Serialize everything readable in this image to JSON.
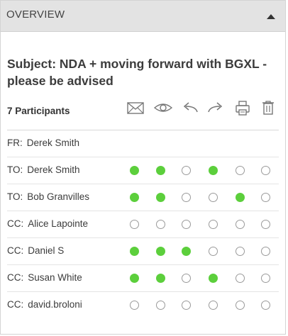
{
  "header": {
    "title": "OVERVIEW",
    "collapse_icon": "caret-up-icon"
  },
  "subject": "Subject: NDA + moving forward with BGXL - please be advised",
  "participants": {
    "count_label": "7 Participants"
  },
  "toolbar": {
    "icons": [
      "envelope-icon",
      "eye-icon",
      "reply-icon",
      "forward-icon",
      "print-icon",
      "trash-icon"
    ]
  },
  "colors": {
    "active_dot": "#5ccf3c",
    "header_bg": "#e3e3e3"
  },
  "rows": [
    {
      "role": "FR:",
      "name": "Derek Smith",
      "status": null
    },
    {
      "role": "TO:",
      "name": "Derek Smith",
      "status": [
        1,
        1,
        0,
        1,
        0,
        0
      ]
    },
    {
      "role": "TO:",
      "name": "Bob Granvilles",
      "status": [
        1,
        1,
        0,
        0,
        1,
        0
      ]
    },
    {
      "role": "CC:",
      "name": "Alice Lapointe",
      "status": [
        0,
        0,
        0,
        0,
        0,
        0
      ]
    },
    {
      "role": "CC:",
      "name": "Daniel S",
      "status": [
        1,
        1,
        1,
        0,
        0,
        0
      ]
    },
    {
      "role": "CC:",
      "name": "Susan White",
      "status": [
        1,
        1,
        0,
        1,
        0,
        0
      ]
    },
    {
      "role": "CC:",
      "name": "david.broloni",
      "status": [
        0,
        0,
        0,
        0,
        0,
        0
      ]
    }
  ]
}
